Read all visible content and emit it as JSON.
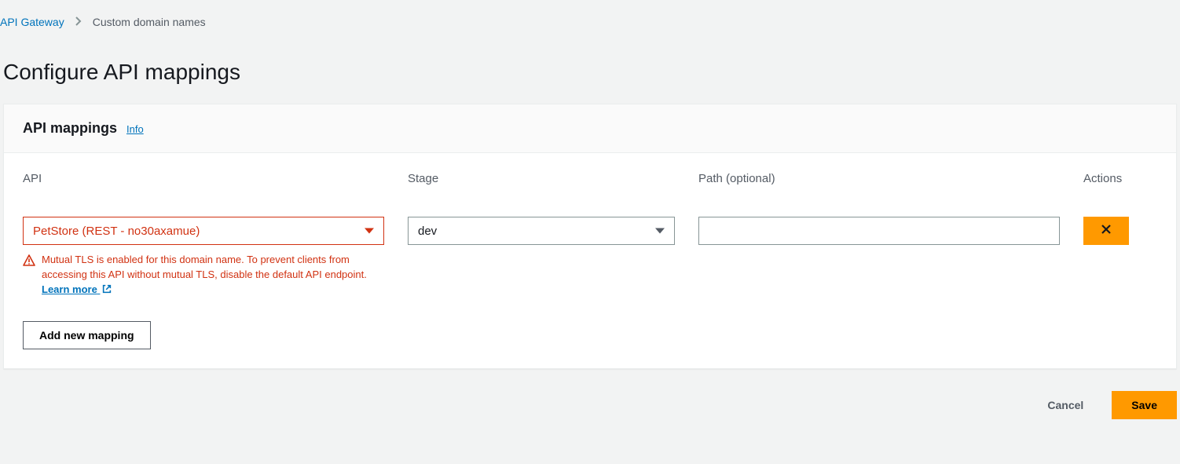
{
  "breadcrumb": {
    "root": "API Gateway",
    "current": "Custom domain names"
  },
  "page_title": "Configure API mappings",
  "panel": {
    "title": "API mappings",
    "info": "Info",
    "columns": {
      "api": "API",
      "stage": "Stage",
      "path": "Path (optional)",
      "actions": "Actions"
    },
    "row": {
      "api_value": "PetStore (REST - no30axamue)",
      "stage_value": "dev",
      "path_value": ""
    },
    "warning": {
      "text": "Mutual TLS is enabled for this domain name. To prevent clients from accessing this API without mutual TLS, disable the default API endpoint. ",
      "link": "Learn more"
    },
    "add_button": "Add new mapping"
  },
  "footer": {
    "cancel": "Cancel",
    "save": "Save"
  }
}
